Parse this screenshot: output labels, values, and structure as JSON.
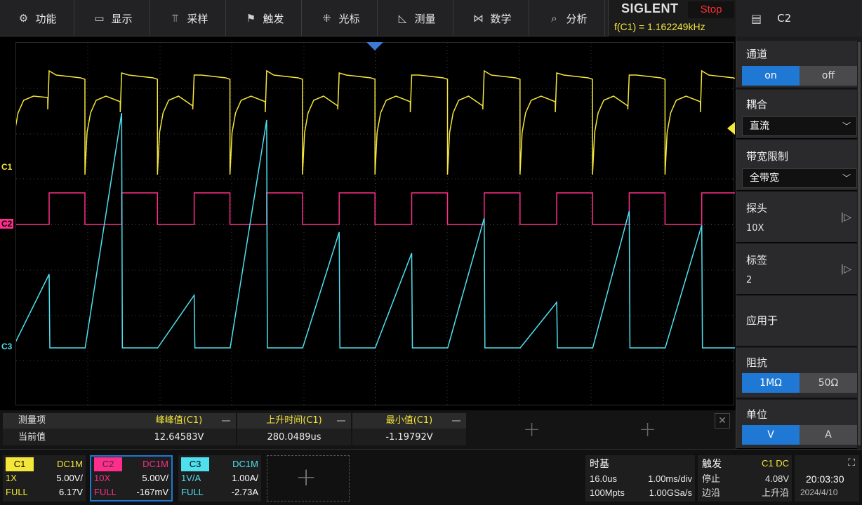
{
  "menu": [
    {
      "label": "功能",
      "icon": "gear-icon",
      "glyph": "⚙"
    },
    {
      "label": "显示",
      "icon": "display-icon",
      "glyph": "▭"
    },
    {
      "label": "采样",
      "icon": "sample-icon",
      "glyph": "⫪"
    },
    {
      "label": "触发",
      "icon": "flag-icon",
      "glyph": "⚑"
    },
    {
      "label": "光标",
      "icon": "cursor-icon",
      "glyph": "⁜"
    },
    {
      "label": "测量",
      "icon": "measure-icon",
      "glyph": "◺"
    },
    {
      "label": "数学",
      "icon": "math-icon",
      "glyph": "⋈"
    },
    {
      "label": "分析",
      "icon": "analysis-icon",
      "glyph": "⌕"
    }
  ],
  "brand": {
    "logo": "SIGLENT",
    "run_state": "Stop",
    "frequency": "f(C1) = 1.162249kHz"
  },
  "panel": {
    "header": "C2",
    "channel_title": "通道",
    "channel_on": "on",
    "channel_off": "off",
    "coupling_title": "耦合",
    "coupling_value": "直流",
    "bandwidth_title": "带宽限制",
    "bandwidth_value": "全带宽",
    "probe_title": "探头",
    "probe_value": "10X",
    "label_title": "标签",
    "label_value": "2",
    "apply_title": "应用于",
    "impedance_title": "阻抗",
    "impedance_1m": "1MΩ",
    "impedance_50": "50Ω",
    "unit_title": "单位",
    "unit_v": "V",
    "unit_a": "A"
  },
  "markers": {
    "c1": "C1",
    "c2": "C2",
    "c3": "C3"
  },
  "colors": {
    "c1": "#f5e63a",
    "c2": "#ff2d8c",
    "c3": "#4fe0f0",
    "accent": "#1e78d4"
  },
  "measurements": {
    "item_label": "测量项",
    "current_label": "当前值",
    "cols": [
      {
        "name": "峰峰值(C1)",
        "value": "12.64583V"
      },
      {
        "name": "上升时间(C1)",
        "value": "280.0489us"
      },
      {
        "name": "最小值(C1)",
        "value": "-1.19792V"
      }
    ]
  },
  "channels": [
    {
      "tag": "C1",
      "coupling": "DC1M",
      "probe": "1X",
      "scale": "5.00V/",
      "bw": "FULL",
      "offset": "6.17V"
    },
    {
      "tag": "C2",
      "coupling": "DC1M",
      "probe": "10X",
      "scale": "5.00V/",
      "bw": "FULL",
      "offset": "-167mV"
    },
    {
      "tag": "C3",
      "coupling": "DC1M",
      "probe": "1V/A",
      "scale": "1.00A/",
      "bw": "FULL",
      "offset": "-2.73A"
    }
  ],
  "timebase": {
    "title": "时基",
    "delay": "16.0us",
    "scale": "1.00ms/div",
    "memory": "100Mpts",
    "rate": "1.00GSa/s"
  },
  "trigger": {
    "title": "触发",
    "source": "C1 DC",
    "state": "停止",
    "level": "4.08V",
    "type": "边沿",
    "slope": "上升沿"
  },
  "clock": {
    "time": "20:03:30",
    "date": "2024/4/10"
  }
}
